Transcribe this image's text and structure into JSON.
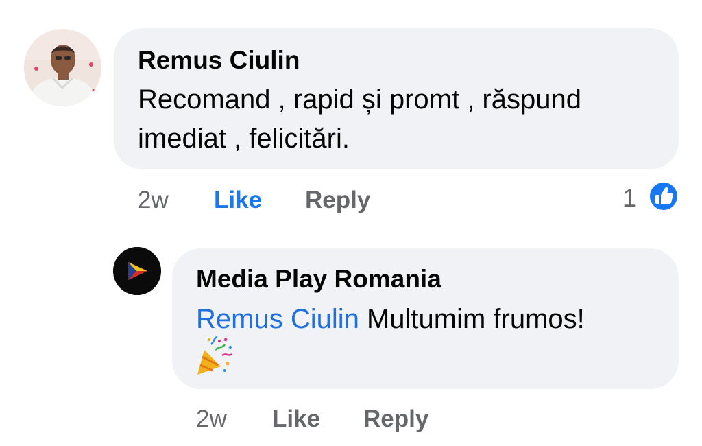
{
  "comment": {
    "author": "Remus Ciulin",
    "text_lines": [
      "Recomand , rapid și promt , răspund",
      "imediat , felicitări."
    ],
    "time": "2w",
    "like_label": "Like",
    "reply_label": "Reply",
    "like_active": true,
    "reaction_count": "1",
    "reaction_icon": "like-reaction-icon"
  },
  "reply": {
    "author": "Media Play Romania",
    "mention": "Remus Ciulin",
    "text": " Multumim frumos!",
    "emoji": "party-popper-icon",
    "time": "2w",
    "like_label": "Like",
    "reply_label": "Reply"
  },
  "colors": {
    "bubble": "#f0f2f5",
    "accent": "#1877f2",
    "mention": "#216fdb",
    "muted": "#65676b"
  }
}
